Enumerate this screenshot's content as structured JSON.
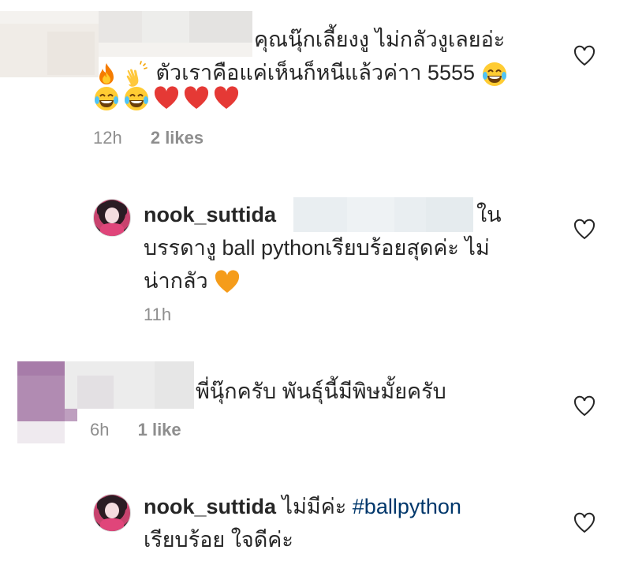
{
  "comments": [
    {
      "text_line1": "คุณนุ๊กเลี้ยงงู ไม่กลัวงูเลยอ่ะ",
      "text_line2": "ตัวเราคือแค่เห็นก็หนีแล้วค่าา 5555",
      "time": "12h",
      "likes": "2 likes",
      "emojis_line2_lead": [
        "fire-emoji",
        "clapping-hands-emoji"
      ],
      "emojis_line2_tail": [
        "tears-of-joy-emoji"
      ],
      "emojis_line3": [
        "tears-of-joy-emoji",
        "tears-of-joy-emoji",
        "red-heart-emoji",
        "red-heart-emoji",
        "red-heart-emoji"
      ]
    },
    {
      "username": "nook_suttida",
      "text_line1_tail": "ใน",
      "text_line2": "บรรดางู ball pythonเรียบร้อยสุดค่ะ ไม่",
      "text_line3": "น่ากลัว",
      "time": "11h",
      "emoji_tail": "orange-heart-emoji"
    },
    {
      "text_line1": "พี่นุ๊กครับ พันธุ์นี้มีพิษมั้ยครับ",
      "time": "6h",
      "likes": "1 like"
    },
    {
      "username": "nook_suttida",
      "text_line1": "ไม่มีค่ะ ",
      "hashtag": "#ballpython",
      "text_line2": "เรียบร้อย ใจดีค่ะ"
    }
  ],
  "colors": {
    "text": "#262626",
    "meta": "#8e8e8e",
    "hashtag": "#00376b",
    "heart_outline": "#262626"
  },
  "icons": {
    "like": "heart-outline-icon"
  }
}
